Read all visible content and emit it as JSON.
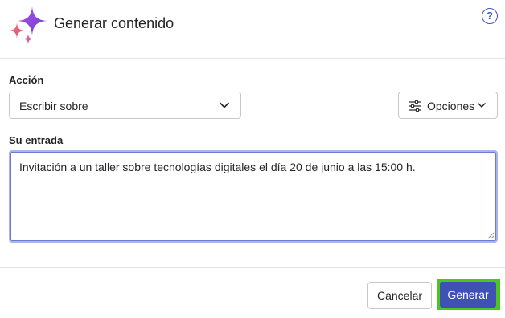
{
  "header": {
    "title": "Generar contenido",
    "help_icon": "question-circle-icon",
    "help_glyph": "?",
    "logo_icon": "sparkle-icon"
  },
  "action": {
    "label": "Acción",
    "selected": "Escribir sobre",
    "chevron_icon": "chevron-down-icon"
  },
  "options_button": {
    "label": "Opciones",
    "icon": "sliders-icon",
    "chevron_icon": "chevron-down-icon"
  },
  "input": {
    "label": "Su entrada",
    "value": "Invitación a un taller sobre tecnologías digitales el día 20 de junio a las 15:00 h."
  },
  "footer": {
    "cancel_label": "Cancelar",
    "generate_label": "Generar"
  },
  "colors": {
    "accent": "#3f51b5",
    "highlight": "#4cc51f",
    "help": "#4257c2",
    "focus_border": "#a9b4e8"
  }
}
